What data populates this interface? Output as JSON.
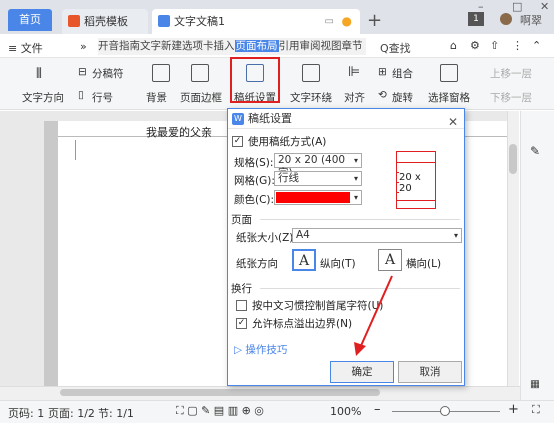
{
  "tabs": {
    "home": "首页",
    "template": "稻壳模板",
    "doc": "文字文稿1"
  },
  "titlebar": {
    "user": "啊翠",
    "page_indicator": "1"
  },
  "menubar": {
    "file": "≡ 文件",
    "more": "»",
    "strip_before": "开始",
    "strip_items": "插入 页面布局 引用 审阅 视图 章节",
    "strip_full_prefix": "开音指南文字新建选项卡插入",
    "strip_highlight": "页面布局",
    "strip_suffix": "引用审阅视图章节",
    "search": "Q查找"
  },
  "ribbon": {
    "split": "分稿符",
    "text_dir": "文字方向",
    "line_num": "行号",
    "background": "背景",
    "border": "页面边框",
    "grid_paper": "稿纸设置",
    "wrap": "文字环绕",
    "align": "对齐",
    "group": "组合",
    "rotate": "旋转",
    "select_pane": "选择窗格",
    "up": "上移一层",
    "down": "下移一层"
  },
  "document": {
    "heading": "我最爱的父亲"
  },
  "statusbar": {
    "page": "页码: 1",
    "page_of": "页面: 1/2",
    "section": "节: 1/1",
    "zoom": "100%"
  },
  "dialog": {
    "title": "稿纸设置",
    "use_grid": "使用稿纸方式(A)",
    "spec_label": "规格(S):",
    "spec_value": "20 x 20 (400 字)",
    "grid_label": "网格(G):",
    "grid_value": "行线",
    "color_label": "颜色(C):",
    "color_value": "#ff0000",
    "preview_text": "20 x 20",
    "page_section": "页面",
    "paper_size_label": "纸张大小(Z):",
    "paper_size_value": "A4",
    "orientation_label": "纸张方向",
    "portrait": "纵向(T)",
    "landscape": "横向(L)",
    "orient_glyph": "A",
    "wrap_section": "换行",
    "opt_cjk": "按中文习惯控制首尾字符(U)",
    "opt_overflow": "允许标点溢出边界(N)",
    "help": "操作技巧",
    "ok": "确定",
    "cancel": "取消"
  },
  "colors": {
    "accent": "#4a86e8",
    "highlight_red": "#e02020"
  }
}
